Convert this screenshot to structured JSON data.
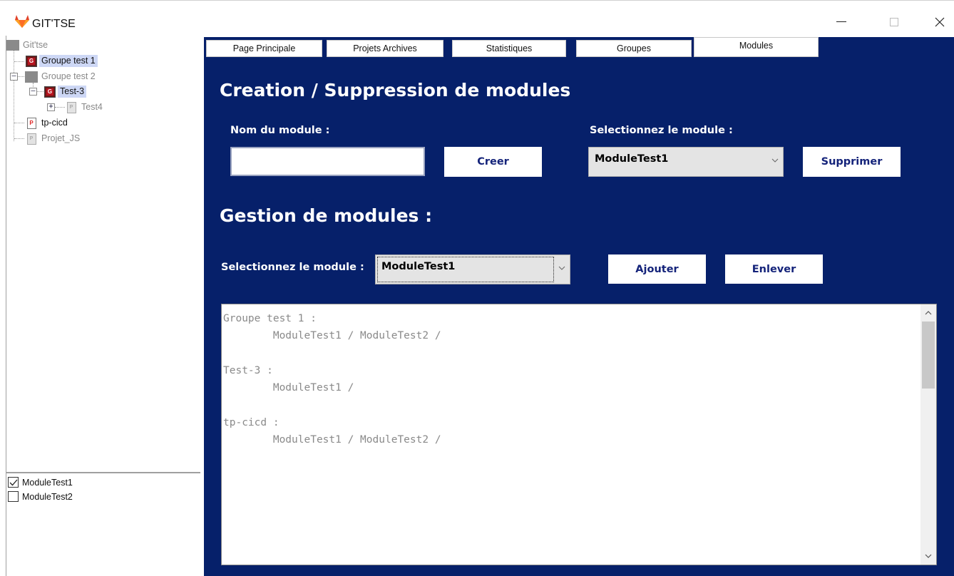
{
  "window": {
    "title": "GIT'TSE"
  },
  "tree": {
    "root": "Git'tse",
    "nodes": [
      "Groupe test 1",
      "Groupe test 2",
      "Test-3",
      "Test4",
      "tp-cicd",
      "Projet_JS"
    ],
    "expanders": [
      "–",
      "–",
      "+"
    ]
  },
  "module_checks": [
    {
      "label": "ModuleTest1",
      "checked": true
    },
    {
      "label": "ModuleTest2",
      "checked": false
    }
  ],
  "tabs": [
    "Page Principale",
    "Projets Archives",
    "Statistiques",
    "Groupes",
    "Modules"
  ],
  "active_tab": "Modules",
  "creation": {
    "title": "Creation / Suppression de modules",
    "name_label": "Nom du module :",
    "name_value": "",
    "create_button": "Creer",
    "select_label": "Selectionnez le module :",
    "selected_module": "ModuleTest1",
    "delete_button": "Supprimer"
  },
  "gestion": {
    "title": "Gestion de modules :",
    "select_label": "Selectionnez le module :",
    "selected_module": "ModuleTest1",
    "add_button": "Ajouter",
    "remove_button": "Enlever"
  },
  "output": {
    "text": "Groupe test 1 :\n\tModuleTest1 / ModuleTest2 /\n\nTest-3 :\n\tModuleTest1 /\n\ntp-cicd :\n\tModuleTest1 / ModuleTest2 /"
  },
  "colors": {
    "panel_background": "#06206a",
    "button_text": "#14237a",
    "tree_selection": "#cdd7f5"
  }
}
